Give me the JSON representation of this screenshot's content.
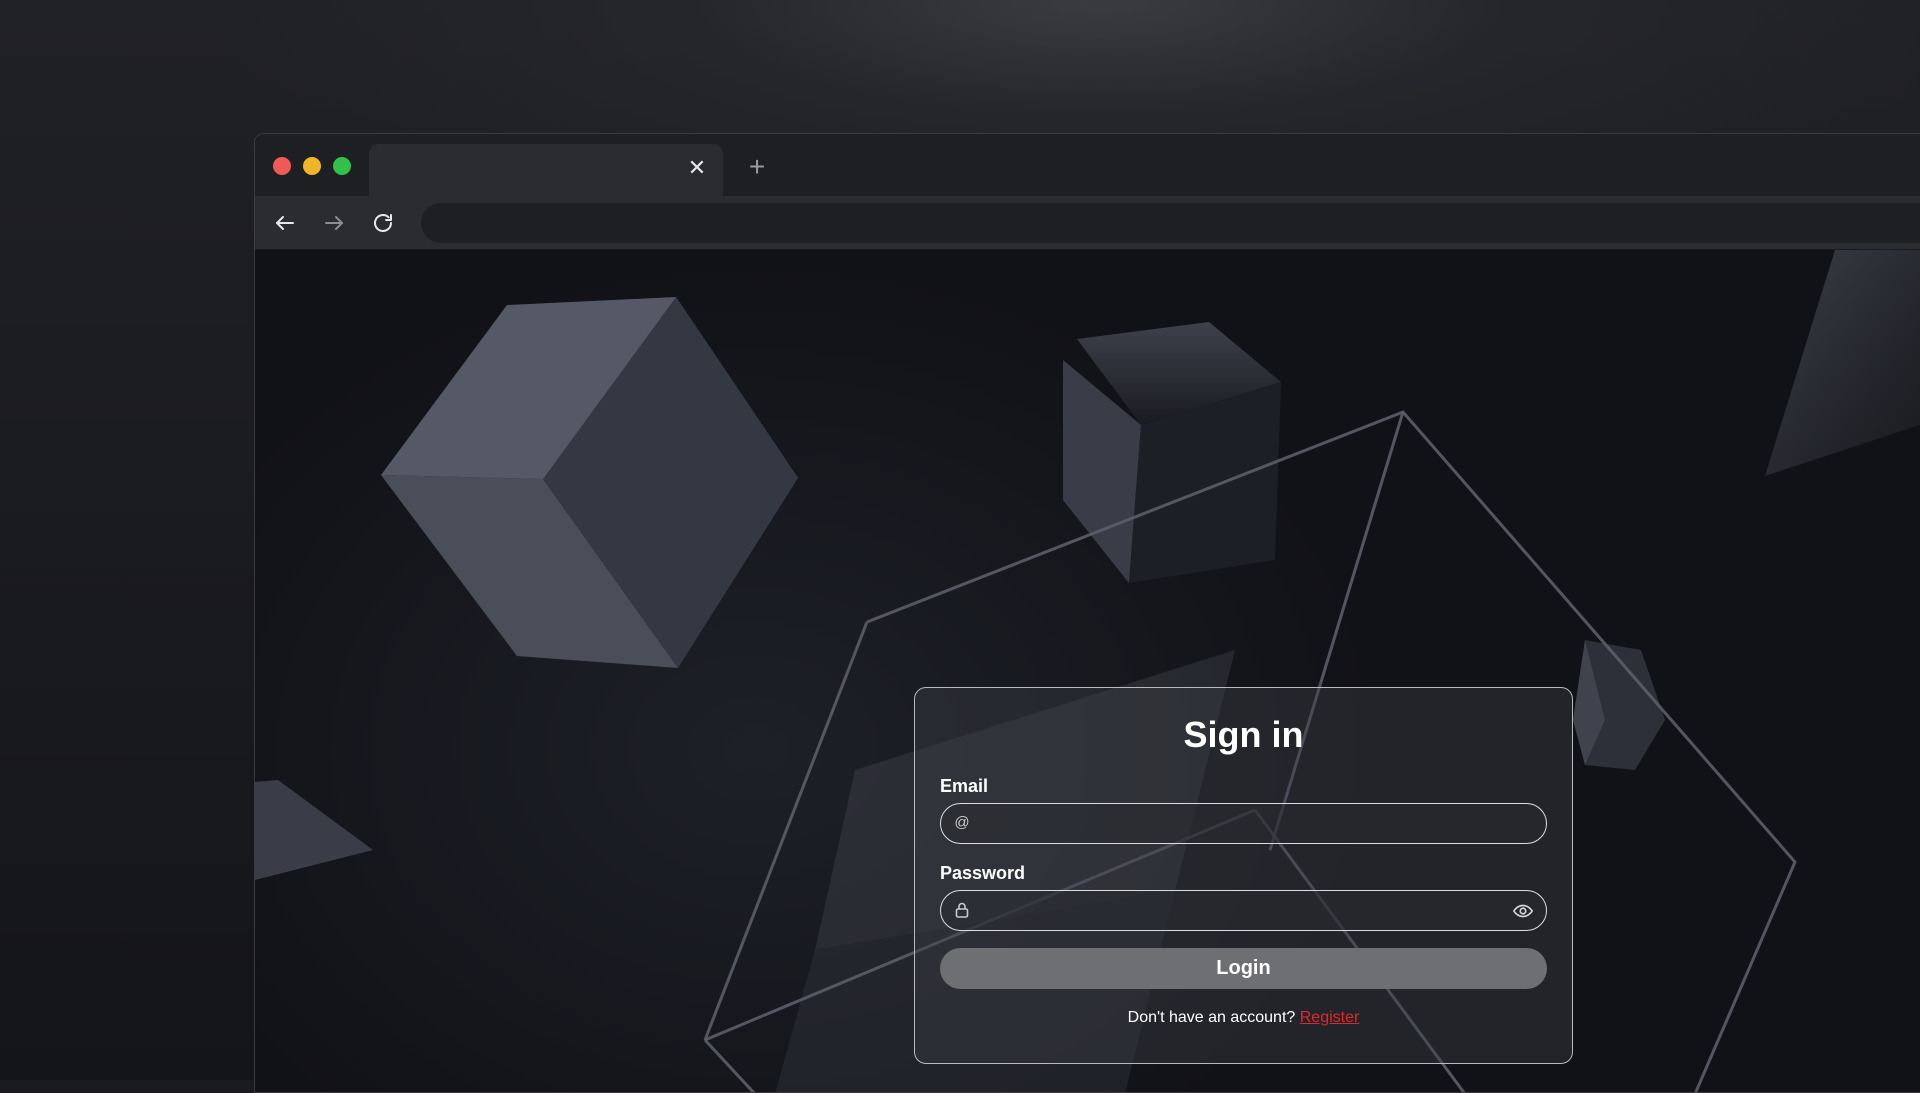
{
  "browser": {
    "tab": {
      "title": "",
      "close_glyph": "✕"
    },
    "new_tab_glyph": "+",
    "address": {
      "value": "",
      "placeholder": ""
    },
    "window_controls": [
      "close",
      "minimize",
      "maximize"
    ],
    "icons": [
      "arrow-left-icon",
      "arrow-right-icon",
      "reload-icon"
    ]
  },
  "login": {
    "title": "Sign in",
    "email": {
      "label": "Email",
      "value": "",
      "placeholder": "",
      "icon": "@"
    },
    "password": {
      "label": "Password",
      "value": "",
      "placeholder": "",
      "icon": "lock-icon",
      "toggle_icon": "eye-icon"
    },
    "submit_label": "Login",
    "footer_text": "Don't have an account?",
    "register_label": "Register"
  },
  "colors": {
    "close_dot": "#ee5b55",
    "minimize_dot": "#f0b429",
    "maximize_dot": "#31c048",
    "register_link": "#e0282a",
    "login_button": "#6e6f73"
  }
}
